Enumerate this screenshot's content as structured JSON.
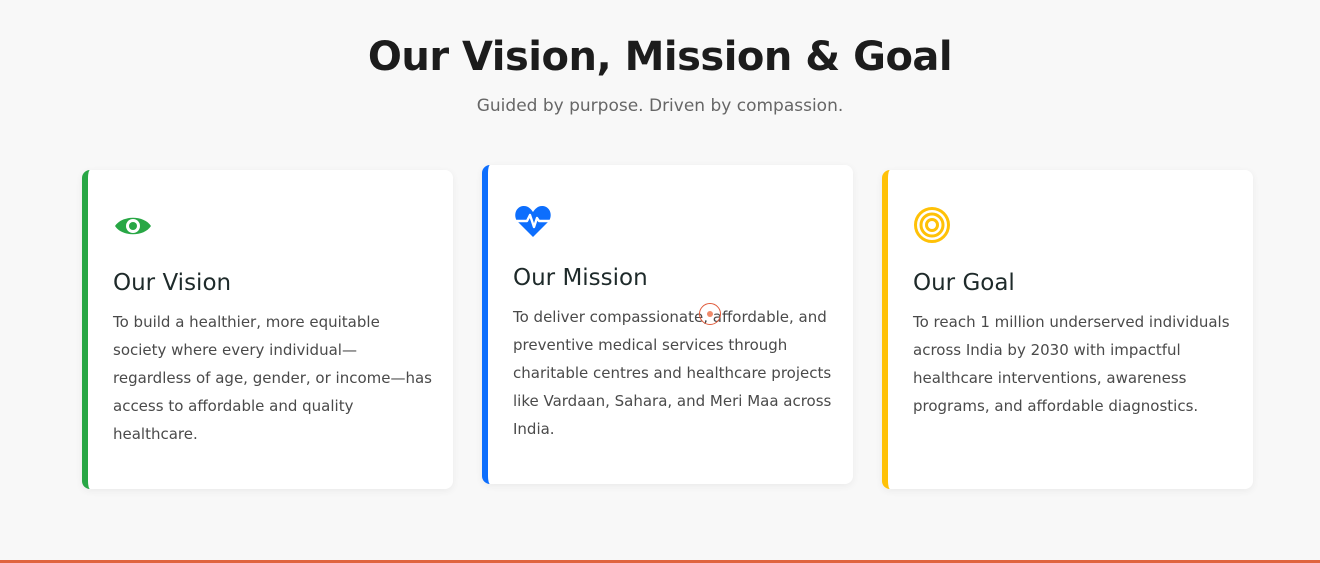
{
  "header": {
    "title": "Our Vision, Mission & Goal",
    "subtitle": "Guided by purpose. Driven by compassion."
  },
  "cards": [
    {
      "icon": "eye-icon",
      "accent": "#28a745",
      "title": "Our Vision",
      "text": "To build a healthier, more equitable society where every individual—regardless of age, gender, or income—has access to affordable and quality healthcare."
    },
    {
      "icon": "heartbeat-icon",
      "accent": "#0d6efd",
      "title": "Our Mission",
      "text": "To deliver compassionate, affordable, and preventive medical services through charitable centres and healthcare projects like Vardaan, Sahara, and Meri Maa across India."
    },
    {
      "icon": "target-icon",
      "accent": "#ffc107",
      "title": "Our Goal",
      "text": "To reach 1 million underserved individuals across India by 2030 with impactful healthcare interventions, awareness programs, and affordable diagnostics."
    }
  ]
}
